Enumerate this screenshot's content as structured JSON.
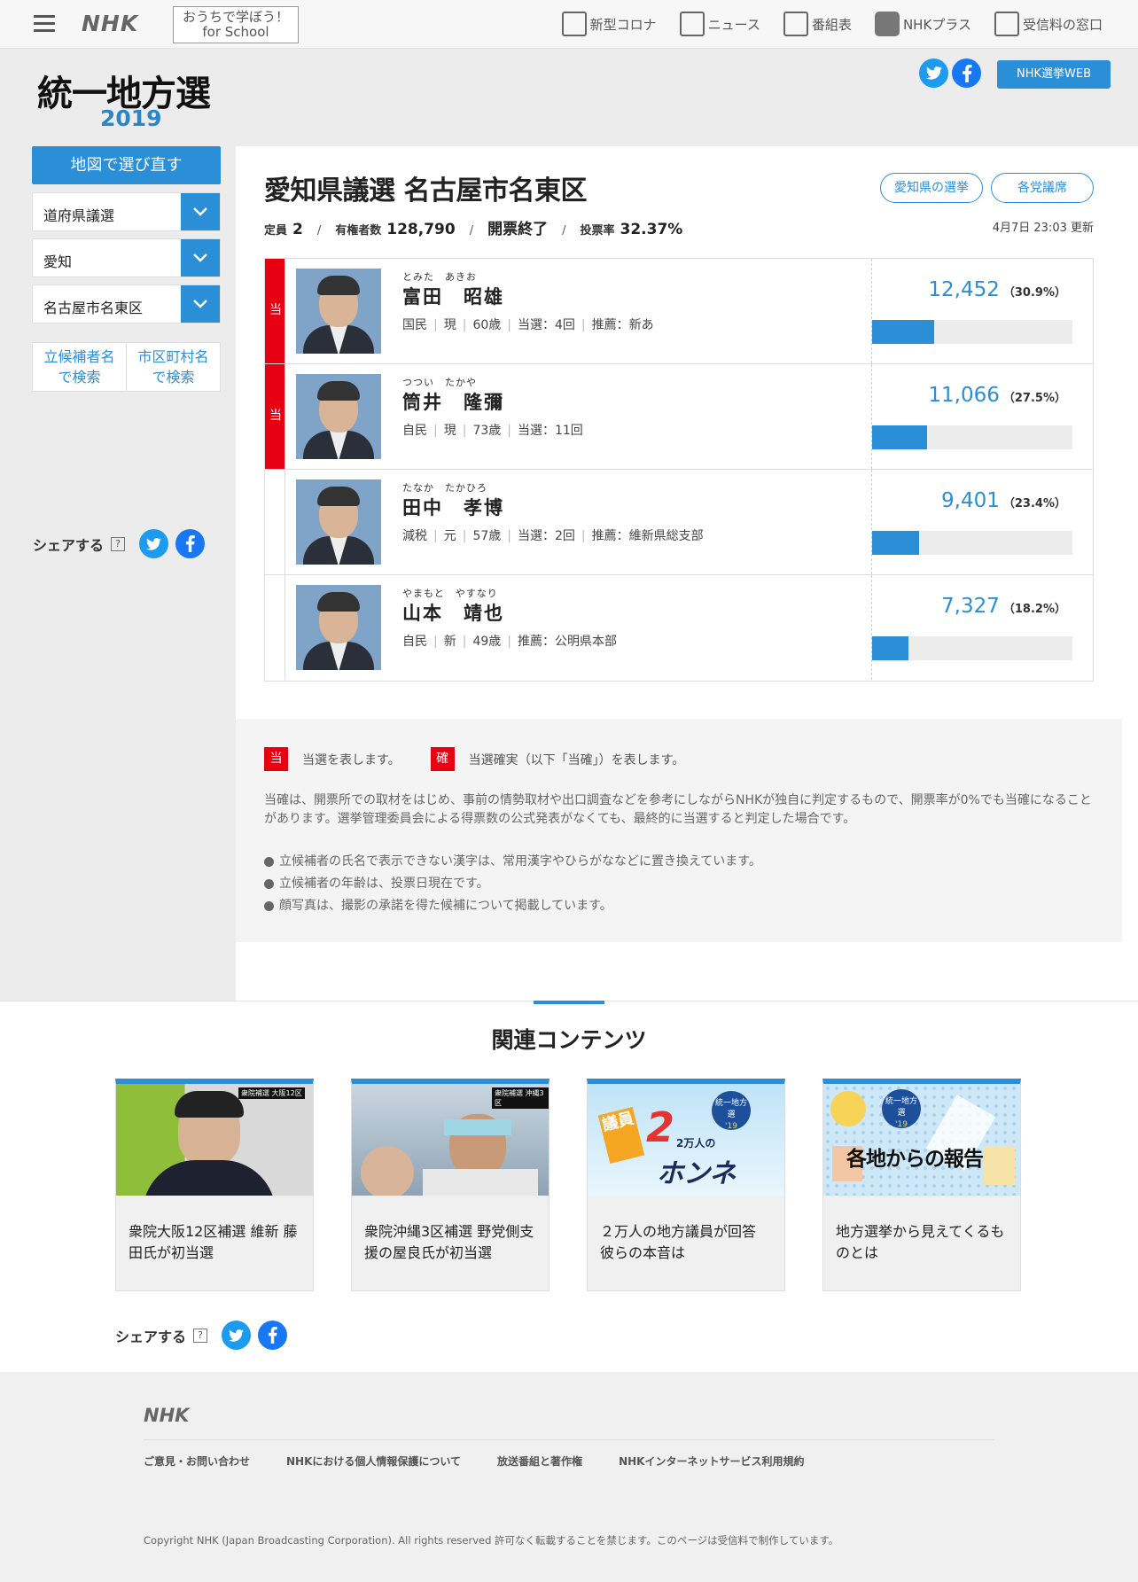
{
  "topbar": {
    "logo": "NHK",
    "school_line1": "おうちで学ぼう！",
    "school_line2": "for School",
    "nav": [
      {
        "label": "新型コロナ",
        "icon": "corona-icon"
      },
      {
        "label": "ニュース",
        "icon": "news-icon"
      },
      {
        "label": "番組表",
        "icon": "program-grid-icon"
      },
      {
        "label": "NHKプラス",
        "icon": "nhk-plus-icon"
      },
      {
        "label": "受信料の窓口",
        "icon": "license-fee-icon"
      }
    ]
  },
  "header": {
    "title": "統一地方選",
    "year": "2019",
    "web_button": "NHK選挙WEB"
  },
  "sidebar": {
    "map_button": "地図で選び直す",
    "selects": [
      "道府県議選",
      "愛知",
      "名古屋市名東区"
    ],
    "search_candidate": [
      "立候補者名",
      "で検索"
    ],
    "search_city": [
      "市区町村名",
      "で検索"
    ],
    "share_label": "シェアする",
    "help": "?"
  },
  "race": {
    "title": "愛知県議選 名古屋市名東区",
    "link_pref": "愛知県の選挙",
    "link_party": "各党議席",
    "seats_label": "定員",
    "seats": "2",
    "electorate_label": "有権者数",
    "electorate": "128,790",
    "status": "開票終了",
    "turnout_label": "投票率",
    "turnout": "32.37%",
    "updated": "4月7日 23:03 更新"
  },
  "candidates": [
    {
      "winner": true,
      "win_mark": "当",
      "ruby": "とみた　あきお",
      "name": "富田　昭雄",
      "meta": [
        "国民",
        "現",
        "60歳",
        "当選：4回",
        "推薦：新あ"
      ],
      "votes": "12,452",
      "pct": "（30.9%）",
      "share": 0.309
    },
    {
      "winner": true,
      "win_mark": "当",
      "ruby": "つつい　たかや",
      "name": "筒井　隆彌",
      "meta": [
        "自民",
        "現",
        "73歳",
        "当選：11回"
      ],
      "votes": "11,066",
      "pct": "（27.5%）",
      "share": 0.275
    },
    {
      "winner": false,
      "win_mark": "",
      "ruby": "たなか　たかひろ",
      "name": "田中　孝博",
      "meta": [
        "減税",
        "元",
        "57歳",
        "当選：2回",
        "推薦：維新県総支部"
      ],
      "votes": "9,401",
      "pct": "（23.4%）",
      "share": 0.234
    },
    {
      "winner": false,
      "win_mark": "",
      "ruby": "やまもと　やすなり",
      "name": "山本　靖也",
      "meta": [
        "自民",
        "新",
        "49歳",
        "推薦：公明県本部"
      ],
      "votes": "7,327",
      "pct": "（18.2%）",
      "share": 0.182
    }
  ],
  "notes": {
    "mark_win": "当",
    "mark_win_text": "当選を表します。",
    "mark_sure": "確",
    "mark_sure_text": "当選確実（以下「当確」）を表します。",
    "paragraph": "当確は、開票所での取材をはじめ、事前の情勢取材や出口調査などを参考にしながらNHKが独自に判定するもので、開票率が0%でも当確になることがあります。選挙管理委員会による得票数の公式発表がなくても、最終的に当選すると判定した場合です。",
    "bullets": [
      "立候補者の氏名で表示できない漢字は、常用漢字やひらがななどに置き換えています。",
      "立候補者の年齢は、投票日現在です。",
      "顔写真は、撮影の承諾を得た候補について掲載しています。"
    ]
  },
  "related": {
    "title": "関連コンテンツ",
    "cards": [
      {
        "caption": "衆院大阪12区補選 維新 藤田氏が初当選",
        "overlay": "衆院補選 大阪12区"
      },
      {
        "caption": "衆院沖縄3区補選 野党側支援の屋良氏が初当選",
        "overlay": "衆院補選 沖縄3区"
      },
      {
        "caption": "２万人の地方議員が回答 彼らの本音は",
        "overlay_a": "議員",
        "overlay_b": "2万人の",
        "overlay_c": "ホンネ",
        "badge": "統一地方選",
        "badge_year": "'19"
      },
      {
        "caption": "地方選挙から見えてくるものとは",
        "overlay": "各地からの報告",
        "badge": "統一地方選",
        "badge_year": "'19"
      }
    ],
    "share_label": "シェアする",
    "help": "?"
  },
  "footer": {
    "logo": "NHK",
    "links": [
      "ご意見・お問い合わせ",
      "NHKにおける個人情報保護について",
      "放送番組と著作権",
      "NHKインターネットサービス利用規約"
    ],
    "copyright": "Copyright NHK (Japan Broadcasting Corporation). All rights reserved 許可なく転載することを禁じます。このページは受信料で制作しています。"
  },
  "colors": {
    "accent": "#2a8fd6",
    "winner": "#e60012"
  }
}
